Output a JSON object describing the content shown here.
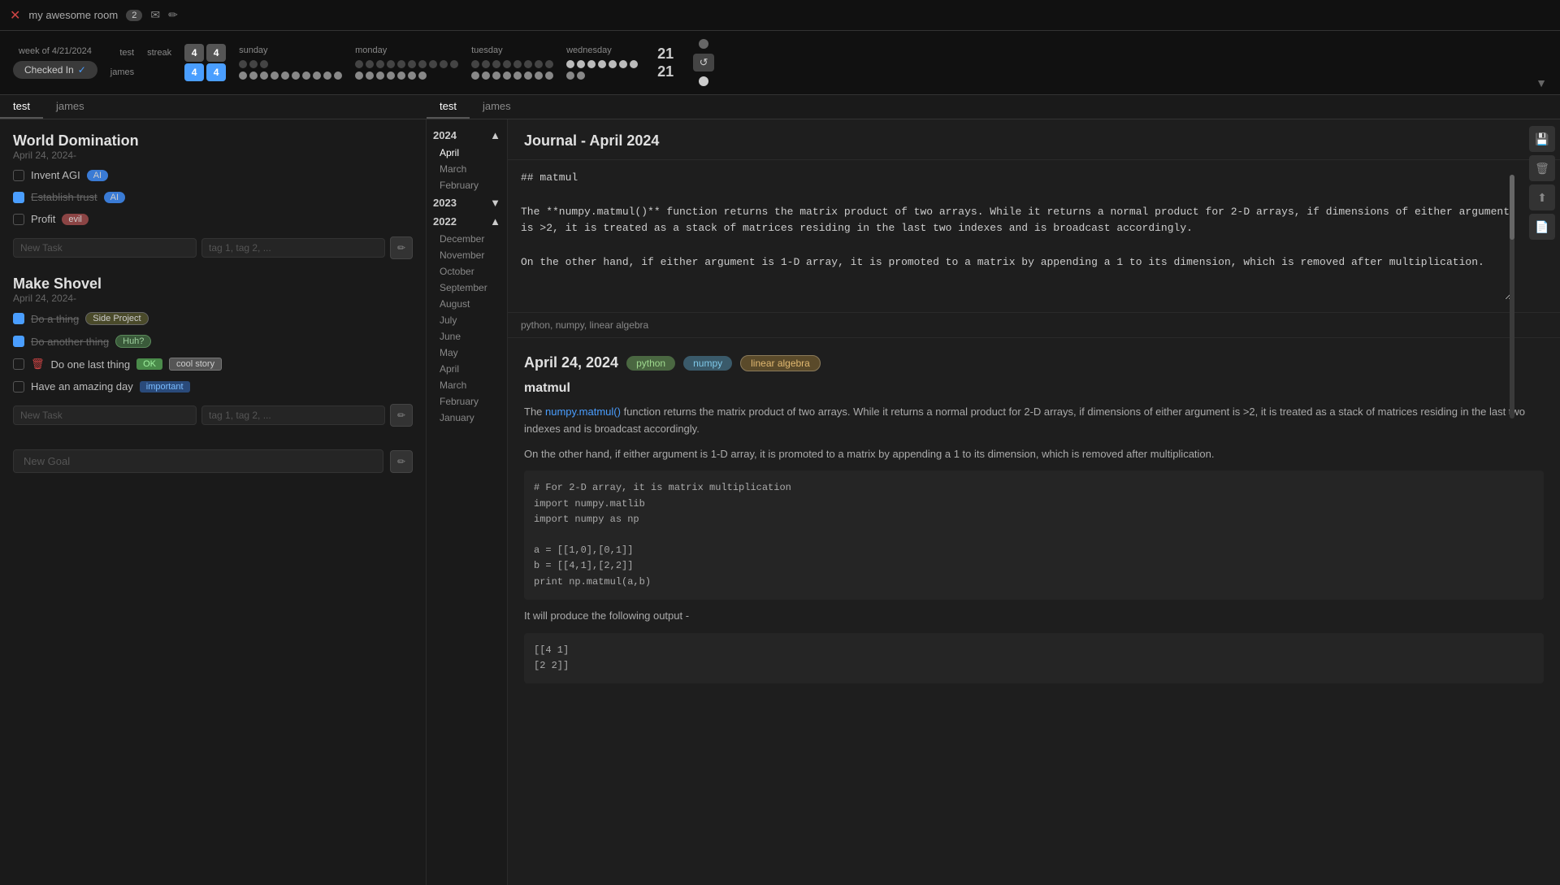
{
  "topbar": {
    "room_name": "my awesome room",
    "badge": "2",
    "icons": [
      "mail-icon",
      "edit-icon"
    ]
  },
  "streak_header": {
    "week_label": "week of 4/21/2024",
    "checked_in_label": "Checked In",
    "users": [
      {
        "name": "test",
        "streak_current": "4",
        "streak_best": "4",
        "days": {
          "sunday": [
            false,
            false,
            false
          ],
          "monday": [
            false,
            false,
            false,
            false,
            false,
            false,
            false,
            false,
            false,
            false
          ],
          "tuesday": [
            false,
            false,
            false,
            false,
            false,
            false,
            false,
            false
          ],
          "wednesday": [
            true,
            true,
            true,
            true,
            true,
            true,
            true
          ],
          "num": "21"
        }
      },
      {
        "name": "james",
        "streak_current": "4",
        "streak_best": "4",
        "days": {
          "sunday": [
            true,
            true,
            true,
            true,
            true,
            true,
            true,
            true,
            true,
            true
          ],
          "monday": [
            true,
            true,
            true,
            true,
            true,
            true,
            true
          ],
          "tuesday": [
            true,
            true,
            true,
            true,
            true,
            true,
            true,
            true
          ],
          "wednesday": [
            true,
            true
          ],
          "num": "21"
        }
      }
    ],
    "day_labels": [
      "sunday",
      "monday",
      "tuesday",
      "wednesday"
    ]
  },
  "tabs_left": {
    "tabs": [
      {
        "label": "test",
        "active": true
      },
      {
        "label": "james",
        "active": false
      }
    ]
  },
  "tabs_right": {
    "tabs": [
      {
        "label": "test",
        "active": true
      },
      {
        "label": "james",
        "active": false
      }
    ]
  },
  "goals": [
    {
      "title": "World Domination",
      "date": "April 24, 2024-",
      "tasks": [
        {
          "label": "Invent AGI",
          "checked": false,
          "tags": [
            {
              "text": "AI",
              "type": "ai"
            }
          ],
          "strikethrough": false
        },
        {
          "label": "Establish trust",
          "checked": true,
          "tags": [
            {
              "text": "AI",
              "type": "ai"
            }
          ],
          "strikethrough": true
        },
        {
          "label": "Profit",
          "checked": false,
          "tags": [
            {
              "text": "evil",
              "type": "evil"
            }
          ],
          "strikethrough": false
        }
      ],
      "new_task_placeholder": "New Task",
      "tag_placeholder": "tag 1, tag 2, ..."
    },
    {
      "title": "Make Shovel",
      "date": "April 24, 2024-",
      "tasks": [
        {
          "label": "Do a thing",
          "checked": true,
          "tags": [
            {
              "text": "Side Project",
              "type": "side-project"
            }
          ],
          "strikethrough": true
        },
        {
          "label": "Do another thing",
          "checked": true,
          "tags": [
            {
              "text": "Huh?",
              "type": "huh"
            }
          ],
          "strikethrough": true
        },
        {
          "label": "Do one last thing",
          "checked": false,
          "tags": [
            {
              "text": "OK",
              "type": "ok"
            },
            {
              "text": "cool story",
              "type": "cool-story"
            }
          ],
          "strikethrough": false,
          "has_delete": true
        },
        {
          "label": "Have an amazing day",
          "checked": false,
          "tags": [
            {
              "text": "important",
              "type": "important"
            }
          ],
          "strikethrough": false
        }
      ],
      "new_task_placeholder": "New Task",
      "tag_placeholder": "tag 1, tag 2, ..."
    }
  ],
  "new_goal_placeholder": "New Goal",
  "calendar": {
    "years": [
      {
        "year": "2024",
        "expanded": true,
        "months": [
          "April",
          "March",
          "February"
        ]
      },
      {
        "year": "2023",
        "expanded": false,
        "months": []
      },
      {
        "year": "2022",
        "expanded": true,
        "months": [
          "December",
          "November",
          "October",
          "September",
          "August",
          "July",
          "June",
          "May",
          "April",
          "March",
          "February",
          "January"
        ]
      }
    ]
  },
  "journal": {
    "title": "Journal - April 2024",
    "editor": {
      "content_h2": "## matmul",
      "content_body": "The **numpy.matmul()** function returns the matrix product of two arrays. While it returns a normal product for 2-D arrays, if dimensions of either argument is >2, it is treated as a stack of matrices residing in the last two indexes and is broadcast accordingly.\n\nOn the other hand, if either argument is 1-D array, it is promoted to a matrix by appending a 1 to its dimension, which is removed after multiplication.",
      "tags": "python, numpy, linear algebra"
    },
    "entry": {
      "date": "April 24, 2024",
      "tags": [
        "python",
        "numpy",
        "linear algebra"
      ],
      "title": "matmul",
      "body_1": "The numpy.matmul() function returns the matrix product of two arrays. While it returns a normal product for 2-D arrays, if dimensions of either argument is >2, it is treated as a stack of matrices residing in the last two indexes and is broadcast accordingly.",
      "body_2": "On the other hand, if either argument is 1-D array, it is promoted to a matrix by appending a 1 to its dimension, which is removed after multiplication.",
      "code_1": "# For 2-D array, it is matrix multiplication\nimport numpy.matlib\nimport numpy as np\n\na = [[1,0],[0,1]]\nb = [[4,1],[2,2]]\nprint np.matmul(a,b)",
      "body_3": "It will produce the following output -",
      "code_2": "[[4  1]\n [2  2]]"
    }
  },
  "action_buttons": {
    "save": "💾",
    "delete": "🗑",
    "upload": "⬆",
    "file": "📄"
  }
}
